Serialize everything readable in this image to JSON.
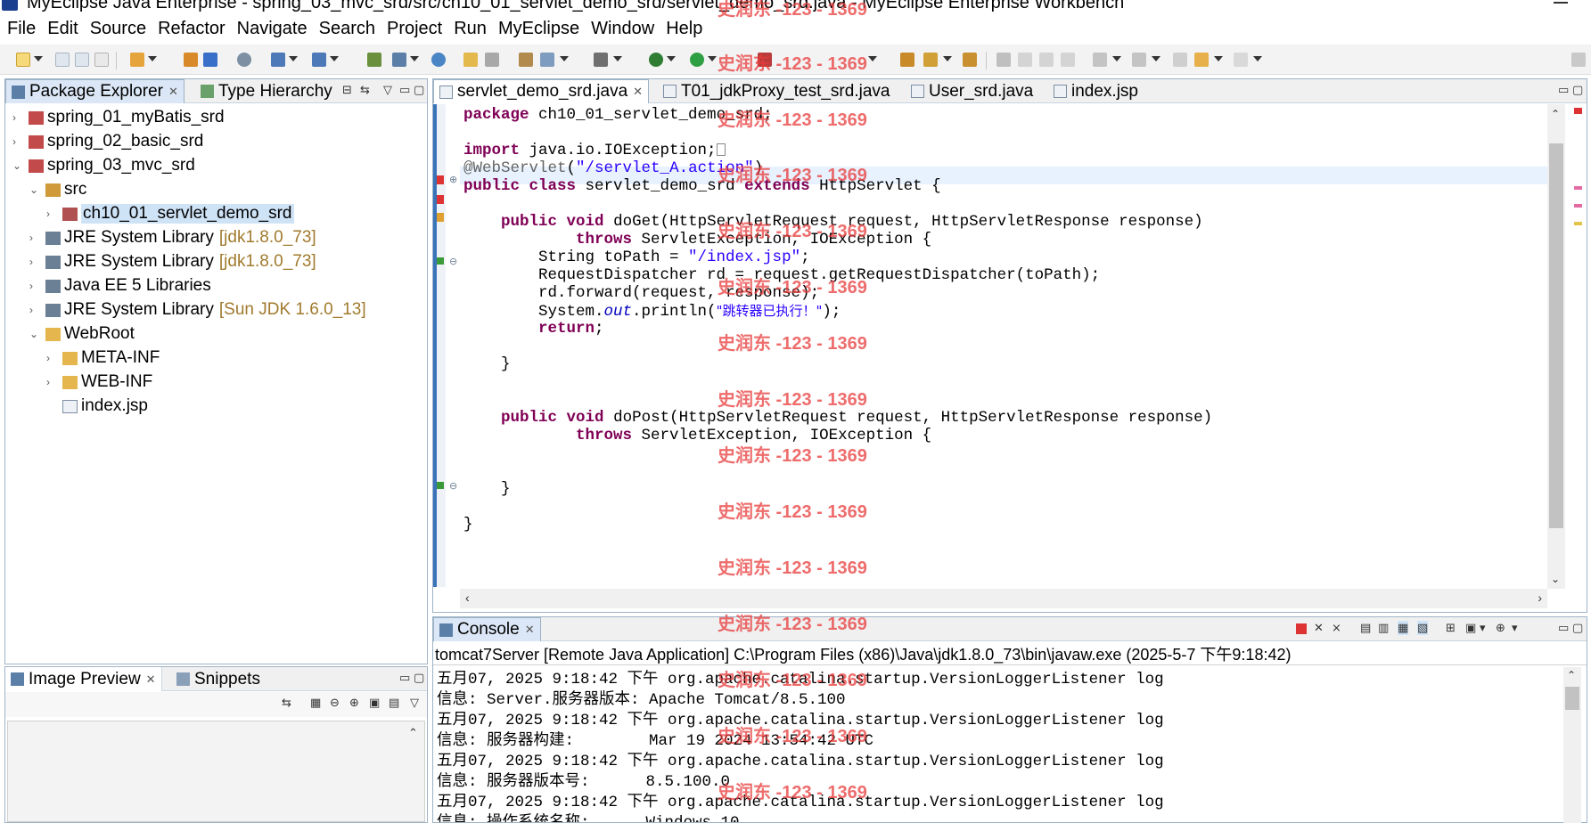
{
  "window": {
    "title": "MyEclipse Java Enterprise - spring_03_mvc_srd/src/ch10_01_servlet_demo_srd/servlet_demo_srd.java - MyEclipse Enterprise Workbench"
  },
  "menu": [
    "File",
    "Edit",
    "Source",
    "Refactor",
    "Navigate",
    "Search",
    "Project",
    "Run",
    "MyEclipse",
    "Window",
    "Help"
  ],
  "left_panel": {
    "tabs": [
      "Package Explorer",
      "Type Hierarchy"
    ],
    "tree": [
      {
        "label": "spring_01_myBatis_srd",
        "extra": ""
      },
      {
        "label": "spring_02_basic_srd",
        "extra": ""
      },
      {
        "label": "spring_03_mvc_srd",
        "extra": ""
      },
      {
        "label": "src",
        "extra": ""
      },
      {
        "label": "ch10_01_servlet_demo_srd",
        "extra": ""
      },
      {
        "label": "JRE System Library",
        "extra": "[jdk1.8.0_73]"
      },
      {
        "label": "JRE System Library",
        "extra": "[jdk1.8.0_73]"
      },
      {
        "label": "Java EE 5 Libraries",
        "extra": ""
      },
      {
        "label": "JRE System Library",
        "extra": "[Sun JDK 1.6.0_13]"
      },
      {
        "label": "WebRoot",
        "extra": ""
      },
      {
        "label": "META-INF",
        "extra": ""
      },
      {
        "label": "WEB-INF",
        "extra": ""
      },
      {
        "label": "index.jsp",
        "extra": ""
      }
    ]
  },
  "bottom_left_panel": {
    "tabs": [
      "Image Preview",
      "Snippets"
    ]
  },
  "editor": {
    "tabs": [
      "servlet_demo_srd.java",
      "T01_jdkProxy_test_srd.java",
      "User_srd.java",
      "index.jsp"
    ],
    "lines": [
      "package ch10_01_servlet_demo_srd;",
      "",
      "import java.io.IOException;",
      "@WebServlet(\"/servlet_A.action\")",
      "public class servlet_demo_srd extends HttpServlet {",
      "",
      "    public void doGet(HttpServletRequest request, HttpServletResponse response)",
      "            throws ServletException, IOException {",
      "        String toPath = \"/index.jsp\";",
      "        RequestDispatcher rd = request.getRequestDispatcher(toPath);",
      "        rd.forward(request, response);",
      "        System.out.println(\"跳转器已执行！\");",
      "        return;",
      "",
      "    }",
      "",
      "",
      "    public void doPost(HttpServletRequest request, HttpServletResponse response)",
      "            throws ServletException, IOException {",
      "",
      "",
      "    }",
      "",
      "}"
    ]
  },
  "console": {
    "tab": "Console",
    "header": "tomcat7Server [Remote Java Application] C:\\Program Files (x86)\\Java\\jdk1.8.0_73\\bin\\javaw.exe (2025-5-7 下午9:18:42)",
    "lines": [
      "五月07, 2025 9:18:42 下午 org.apache.catalina.startup.VersionLoggerListener log",
      "信息: Server.服务器版本: Apache Tomcat/8.5.100",
      "五月07, 2025 9:18:42 下午 org.apache.catalina.startup.VersionLoggerListener log",
      "信息: 服务器构建:        Mar 19 2024 13:54:42 UTC",
      "五月07, 2025 9:18:42 下午 org.apache.catalina.startup.VersionLoggerListener log",
      "信息: 服务器版本号:      8.5.100.0",
      "五月07, 2025 9:18:42 下午 org.apache.catalina.startup.VersionLoggerListener log",
      "信息: 操作系统名称:      Windows 10"
    ]
  },
  "watermark": "史润东 -123 - 1369"
}
